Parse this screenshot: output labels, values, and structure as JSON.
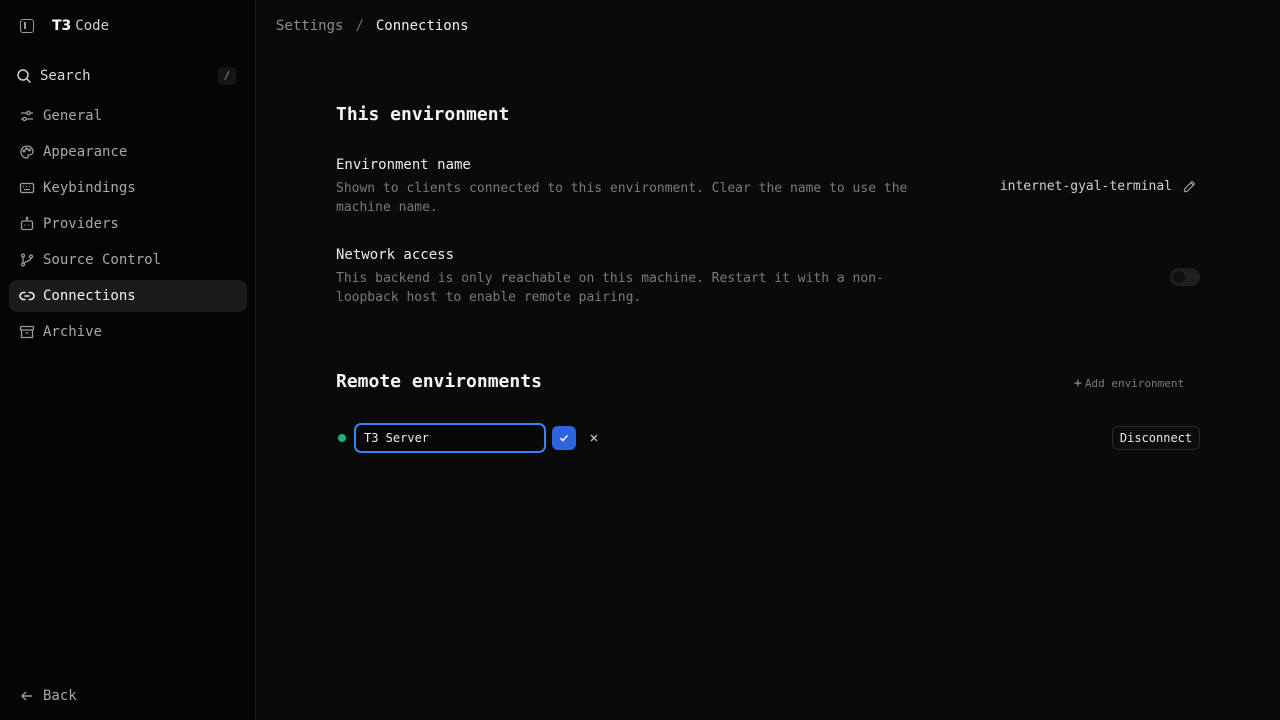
{
  "sidebar": {
    "brand_logo": "T3",
    "brand_name": "Code",
    "search_label": "Search",
    "search_shortcut": "/",
    "items": [
      {
        "label": "General",
        "icon": "sliders-icon"
      },
      {
        "label": "Appearance",
        "icon": "palette-icon"
      },
      {
        "label": "Keybindings",
        "icon": "keyboard-icon"
      },
      {
        "label": "Providers",
        "icon": "bot-icon"
      },
      {
        "label": "Source Control",
        "icon": "git-branch-icon"
      },
      {
        "label": "Connections",
        "icon": "link-icon",
        "active": true
      },
      {
        "label": "Archive",
        "icon": "archive-icon"
      }
    ],
    "back_label": "Back"
  },
  "breadcrumb": {
    "parent": "Settings",
    "separator": "/",
    "current": "Connections"
  },
  "this_environment": {
    "title": "This environment",
    "env_name": {
      "title": "Environment name",
      "description": "Shown to clients connected to this environment. Clear the name to use the machine name.",
      "value": "internet-gyal-terminal"
    },
    "network_access": {
      "title": "Network access",
      "description": "This backend is only reachable on this machine. Restart it with a non-loopback host to enable remote pairing.",
      "enabled": false
    }
  },
  "remote_environments": {
    "title": "Remote environments",
    "add_label": "Add environment",
    "items": [
      {
        "name_value": "T3 Server",
        "status": "connected",
        "status_color": "#10b981",
        "disconnect_label": "Disconnect"
      }
    ]
  },
  "colors": {
    "accent": "#3b82f6",
    "confirm": "#2f63e0",
    "status_connected": "#10b981"
  }
}
